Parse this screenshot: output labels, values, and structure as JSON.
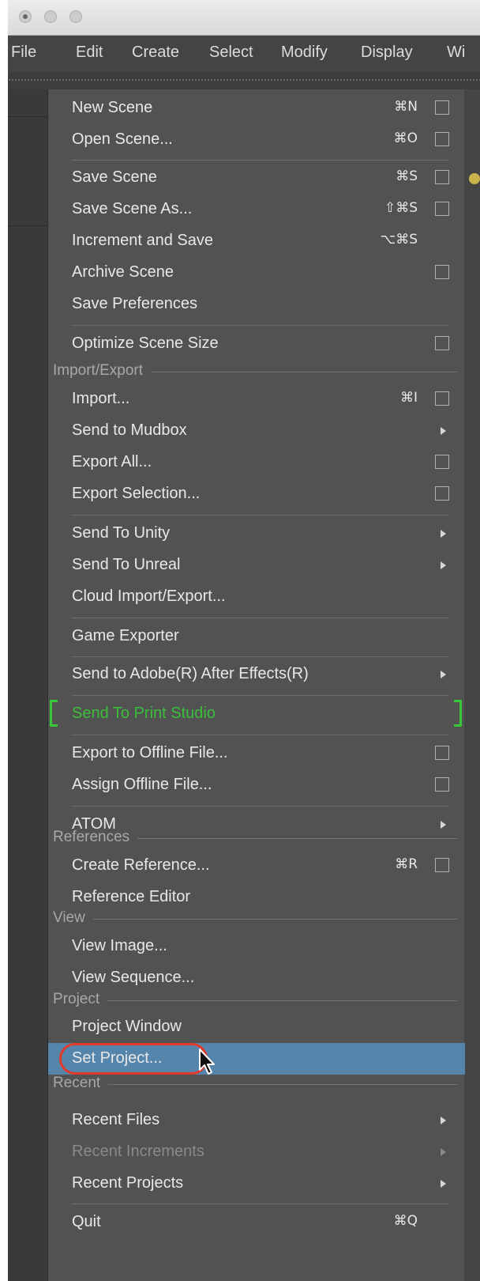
{
  "menubar": {
    "items": [
      "File",
      "Edit",
      "Create",
      "Select",
      "Modify",
      "Display",
      "Wi"
    ]
  },
  "menu": {
    "items": [
      {
        "label": "New Scene",
        "shortcut": "⌘N",
        "option_box": true
      },
      {
        "label": "Open Scene...",
        "shortcut": "⌘O",
        "option_box": true
      },
      {
        "label": "Save Scene",
        "shortcut": "⌘S",
        "option_box": true
      },
      {
        "label": "Save Scene As...",
        "shortcut": "⇧⌘S",
        "option_box": true
      },
      {
        "label": "Increment and Save",
        "shortcut": "⌥⌘S"
      },
      {
        "label": "Archive Scene",
        "option_box": true
      },
      {
        "label": "Save Preferences"
      },
      {
        "label": "Optimize Scene Size",
        "option_box": true
      },
      {
        "label": "Import...",
        "shortcut": "⌘I",
        "option_box": true
      },
      {
        "label": "Send to Mudbox",
        "submenu": true
      },
      {
        "label": "Export All...",
        "option_box": true
      },
      {
        "label": "Export Selection...",
        "option_box": true
      },
      {
        "label": "Send To Unity",
        "submenu": true
      },
      {
        "label": "Send To Unreal",
        "submenu": true
      },
      {
        "label": "Cloud Import/Export..."
      },
      {
        "label": "Game Exporter"
      },
      {
        "label": "Send to Adobe(R) After Effects(R)",
        "submenu": true
      },
      {
        "label": "Send To Print Studio"
      },
      {
        "label": "Export to Offline File...",
        "option_box": true
      },
      {
        "label": "Assign Offline File...",
        "option_box": true
      },
      {
        "label": "ATOM",
        "submenu": true
      },
      {
        "label": "Create Reference...",
        "shortcut": "⌘R",
        "option_box": true
      },
      {
        "label": "Reference Editor"
      },
      {
        "label": "View Image..."
      },
      {
        "label": "View Sequence..."
      },
      {
        "label": "Project Window"
      },
      {
        "label": "Set Project..."
      },
      {
        "label": "Recent Files",
        "submenu": true
      },
      {
        "label": "Recent Increments",
        "submenu": true
      },
      {
        "label": "Recent Projects",
        "submenu": true
      },
      {
        "label": "Quit",
        "shortcut": "⌘Q"
      }
    ],
    "sections": [
      "Import/Export",
      "References",
      "View",
      "Project",
      "Recent"
    ]
  },
  "colors": {
    "menu_bg": "#525252",
    "highlight": "#5685ab",
    "print_studio_green": "#3bbf3b",
    "annotation_red": "#e23a2a"
  }
}
